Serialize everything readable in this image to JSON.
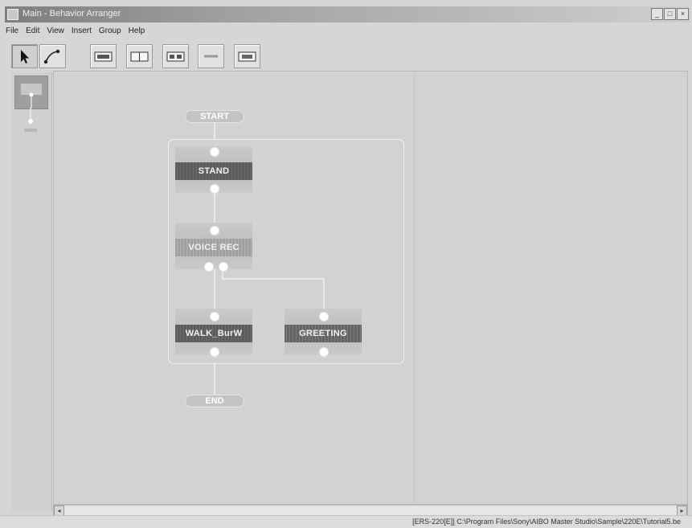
{
  "window": {
    "title": "Main - Behavior Arranger"
  },
  "window_controls": {
    "minimize": "_",
    "restore": "□",
    "close": "×"
  },
  "menu": [
    "File",
    "Edit",
    "View",
    "Insert",
    "Group",
    "Help"
  ],
  "toolbar": {
    "buttons": [
      "select",
      "connect",
      "state",
      "split",
      "join",
      "link",
      "group"
    ]
  },
  "flow": {
    "start": "START",
    "end": "END",
    "nodes": [
      "STAND",
      "VOICE REC",
      "WALK_BurW",
      "GREETING"
    ]
  },
  "scrollbar": {
    "left": "◂",
    "right": "▸"
  },
  "status": {
    "text": "[ERS-220[E]] C:\\Program Files\\Sony\\AIBO Master Studio\\Sample\\220E\\Tutorial5.be"
  },
  "icons": [
    "pointer-icon",
    "connect-tool-icon",
    "state-icon",
    "split-icon",
    "join-icon",
    "link-icon",
    "group-icon",
    "app-icon"
  ],
  "colors": {
    "canvas": "#d2d2d2",
    "node_bar": "#5e5e5e",
    "port": "#ffffff",
    "title_gradient_start": "#7e7e7e"
  }
}
